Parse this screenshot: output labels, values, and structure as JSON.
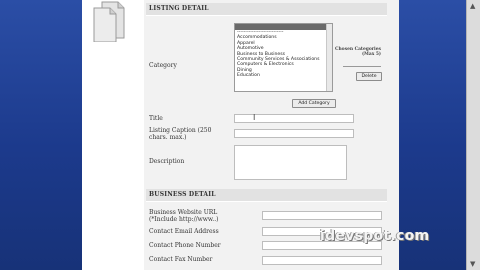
{
  "listing_detail": {
    "header": "LISTING DETAIL",
    "category_label": "Category",
    "category_options": [
      "----------------------------",
      "Accommodations",
      "Apparel",
      "Automotive",
      "Business to Business",
      "Community Services & Associations",
      "Computers & Electronics",
      "Dining",
      "Education"
    ],
    "chosen_label": "Chosen Categories (Max 5)",
    "chosen_sub": "",
    "delete_button": "Delete",
    "add_category_button": "Add Category",
    "title_label": "Title",
    "title_value": "",
    "caption_label": "Listing Caption (250 chars. max.)",
    "description_label": "Description"
  },
  "business_detail": {
    "header": "BUSINESS DETAIL",
    "website_label": "Business Website URL (*Include http://www..)",
    "email_label": "Contact Email Address",
    "phone_label": "Contact Phone Number",
    "fax_label": "Contact Fax Number"
  },
  "watermark": "idevspot.com"
}
